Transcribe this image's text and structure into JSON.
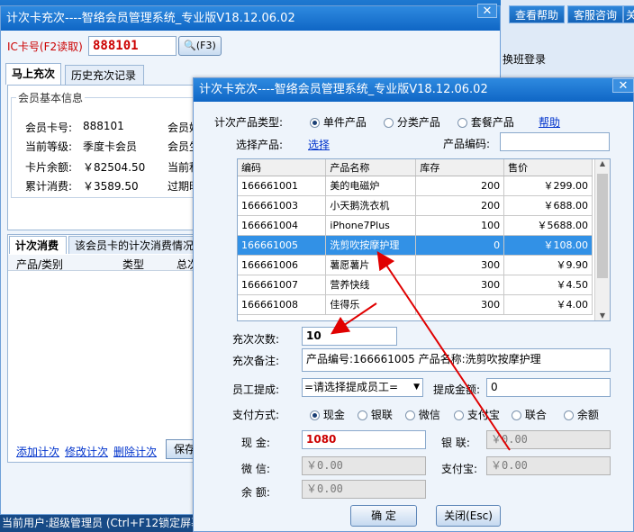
{
  "background": {
    "top_buttons": [
      "查看帮助",
      "客服咨询",
      "关"
    ],
    "shift_login": "换班登录",
    "status": "当前用户:超级管理员  (Ctrl+F12锁定屏幕"
  },
  "main_window": {
    "title": "计次卡充次----智络会员管理系统_专业版V18.12.06.02",
    "ic_label": "IC卡号(F2读取)",
    "ic_value": "888101",
    "read_button": "(F3)",
    "tabs": [
      "马上充次",
      "历史充次记录"
    ],
    "member_section": "会员基本信息",
    "fields": [
      {
        "label": "会员卡号:",
        "value": "888101",
        "right": "会员姓"
      },
      {
        "label": "当前等级:",
        "value": "季度卡会员",
        "right": "会员生"
      },
      {
        "label": "卡片余额:",
        "value": "￥82504.50",
        "right": "当前积"
      },
      {
        "label": "累计消费:",
        "value": "￥3589.50",
        "right": "过期时"
      }
    ],
    "sub_tabs": [
      "计次消费",
      "该会员卡的计次消费情况"
    ],
    "grid_columns": [
      "产品/类别",
      "类型",
      "总次"
    ],
    "links": [
      "添加计次",
      "修改计次",
      "删除计次"
    ],
    "save_button": "保存"
  },
  "dialog": {
    "title": "计次卡充次----智络会员管理系统_专业版V18.12.06.02",
    "product_type_label": "计次产品类型:",
    "product_types": [
      "单件产品",
      "分类产品",
      "套餐产品"
    ],
    "help_link": "帮助",
    "select_label": "选择产品:",
    "select_link": "选择",
    "code_label": "产品编码:",
    "code_value": "",
    "columns": [
      "编码",
      "产品名称",
      "库存",
      "售价"
    ],
    "products": [
      {
        "code": "166661001",
        "name": "美的电磁炉",
        "stock": "200",
        "price": "￥299.00"
      },
      {
        "code": "166661003",
        "name": "小天鹅洗衣机",
        "stock": "200",
        "price": "￥688.00"
      },
      {
        "code": "166661004",
        "name": "iPhone7Plus",
        "stock": "100",
        "price": "￥5688.00"
      },
      {
        "code": "166661005",
        "name": "洗剪吹按摩护理",
        "stock": "0",
        "price": "￥108.00"
      },
      {
        "code": "166661006",
        "name": "薯愿薯片",
        "stock": "300",
        "price": "￥9.90"
      },
      {
        "code": "166661007",
        "name": "营养快线",
        "stock": "300",
        "price": "￥4.50"
      },
      {
        "code": "166661008",
        "name": "佳得乐",
        "stock": "300",
        "price": "￥4.00"
      }
    ],
    "selected_row": 3,
    "count_label": "充次次数:",
    "count_value": "10",
    "note_label": "充次备注:",
    "note_value": "产品编号:166661005 产品名称:洗剪吹按摩护理",
    "staff_label": "员工提成:",
    "staff_value": "=请选择提成员工=",
    "commission_label": "提成金额:",
    "commission_value": "0",
    "pay_label": "支付方式:",
    "pay_methods": [
      "现金",
      "银联",
      "微信",
      "支付宝",
      "联合",
      "余额"
    ],
    "cash_label": "现  金:",
    "cash_value": "1080",
    "unionpay_label": "银  联:",
    "unionpay_value": "￥0.00",
    "wechat_label": "微  信:",
    "wechat_value": "￥0.00",
    "alipay_label": "支付宝:",
    "alipay_value": "￥0.00",
    "balance_label": "余  额:",
    "balance_value": "￥0.00",
    "ok_button": "确    定",
    "close_button": "关闭(Esc)"
  },
  "colors": {
    "titlebar": "#1a73d2",
    "accent_red": "#cc0000",
    "selection": "#3291e6",
    "arrow": "#e00000"
  }
}
